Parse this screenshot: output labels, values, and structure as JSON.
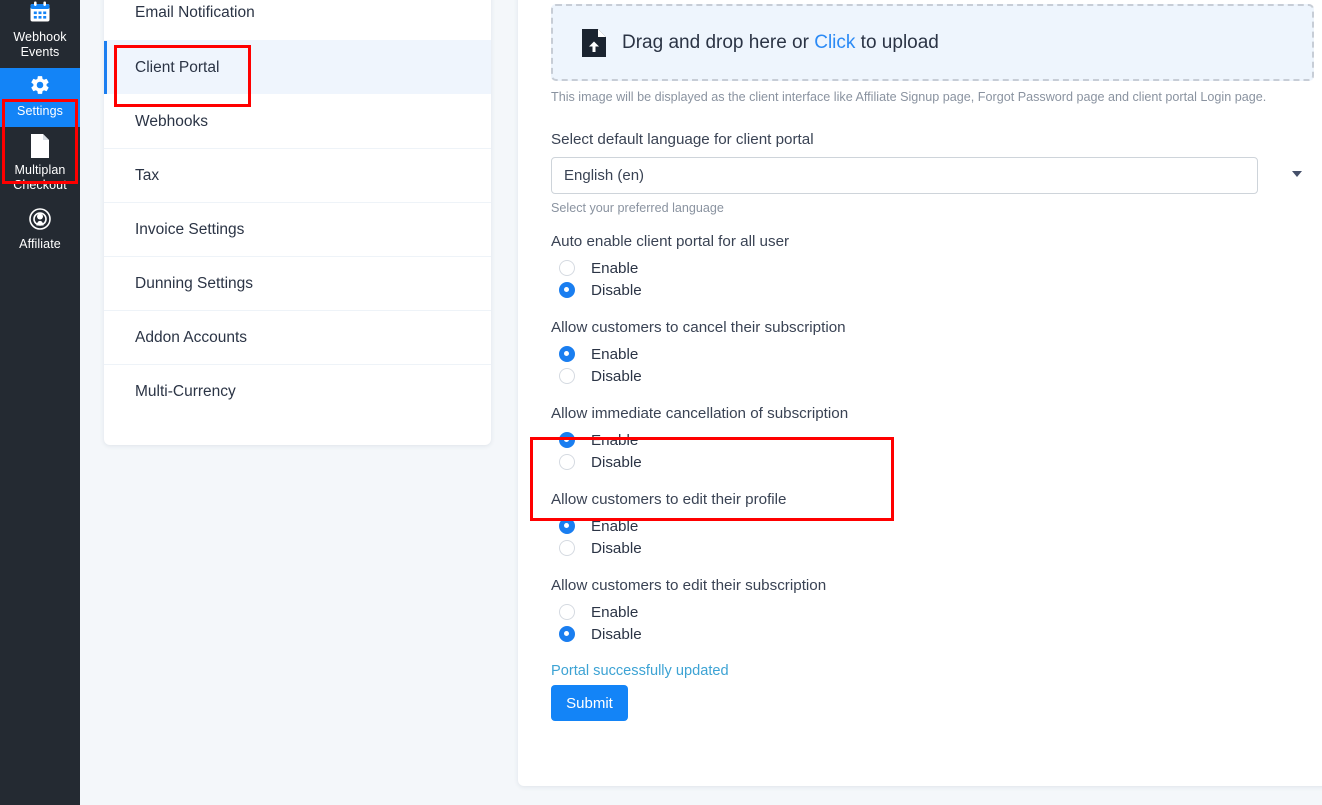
{
  "app": {
    "rail": {
      "items": [
        {
          "id": "webhook-events",
          "label": "Webhook Events",
          "icon": "calendar-icon",
          "active": false
        },
        {
          "id": "settings",
          "label": "Settings",
          "icon": "gear-icon",
          "active": true
        },
        {
          "id": "multiplan-checkout",
          "label": "Multiplan Checkout",
          "icon": "document-icon",
          "active": false
        },
        {
          "id": "affiliate",
          "label": "Affiliate",
          "icon": "broadcast-icon",
          "active": false
        }
      ]
    },
    "settings_menu": {
      "items": [
        {
          "id": "email-notification",
          "label": "Email Notification",
          "active": false
        },
        {
          "id": "client-portal",
          "label": "Client Portal",
          "active": true
        },
        {
          "id": "webhooks",
          "label": "Webhooks",
          "active": false
        },
        {
          "id": "tax",
          "label": "Tax",
          "active": false
        },
        {
          "id": "invoice-settings",
          "label": "Invoice Settings",
          "active": false
        },
        {
          "id": "dunning-settings",
          "label": "Dunning Settings",
          "active": false
        },
        {
          "id": "addon-accounts",
          "label": "Addon Accounts",
          "active": false
        },
        {
          "id": "multi-currency",
          "label": "Multi-Currency",
          "active": false
        }
      ]
    },
    "content": {
      "upload": {
        "icon": "file-upload-icon",
        "text_before": "Drag and drop here or ",
        "link_text": "Click",
        "text_after": " to upload",
        "help": "This image will be displayed as the client interface like Affiliate Signup page, Forgot Password page and client portal Login page."
      },
      "language": {
        "label": "Select default language for client portal",
        "value": "English (en)",
        "help": "Select your preferred language",
        "caret_icon": "chevron-down-icon"
      },
      "option_groups": [
        {
          "id": "auto-enable-client-portal",
          "title": "Auto enable client portal for all user",
          "options": [
            {
              "label": "Enable",
              "selected": false
            },
            {
              "label": "Disable",
              "selected": true
            }
          ]
        },
        {
          "id": "allow-cancel-subscription",
          "title": "Allow customers to cancel their subscription",
          "options": [
            {
              "label": "Enable",
              "selected": true
            },
            {
              "label": "Disable",
              "selected": false
            }
          ]
        },
        {
          "id": "allow-immediate-cancellation",
          "title": "Allow immediate cancellation of subscription",
          "options": [
            {
              "label": "Enable",
              "selected": true
            },
            {
              "label": "Disable",
              "selected": false
            }
          ]
        },
        {
          "id": "allow-edit-profile",
          "title": "Allow customers to edit their profile",
          "options": [
            {
              "label": "Enable",
              "selected": true
            },
            {
              "label": "Disable",
              "selected": false
            }
          ]
        },
        {
          "id": "allow-edit-subscription",
          "title": "Allow customers to edit their subscription",
          "options": [
            {
              "label": "Enable",
              "selected": false
            },
            {
              "label": "Disable",
              "selected": true
            }
          ]
        }
      ],
      "status_message": "Portal successfully updated",
      "submit_label": "Submit"
    },
    "colors": {
      "rail_bg": "#242a32",
      "accent_blue": "#1384f7",
      "active_menu_bg": "#eff5fd",
      "status_text": "#3da3d4",
      "highlight_red": "#ff0000",
      "page_bg": "#f4f7fa"
    }
  }
}
